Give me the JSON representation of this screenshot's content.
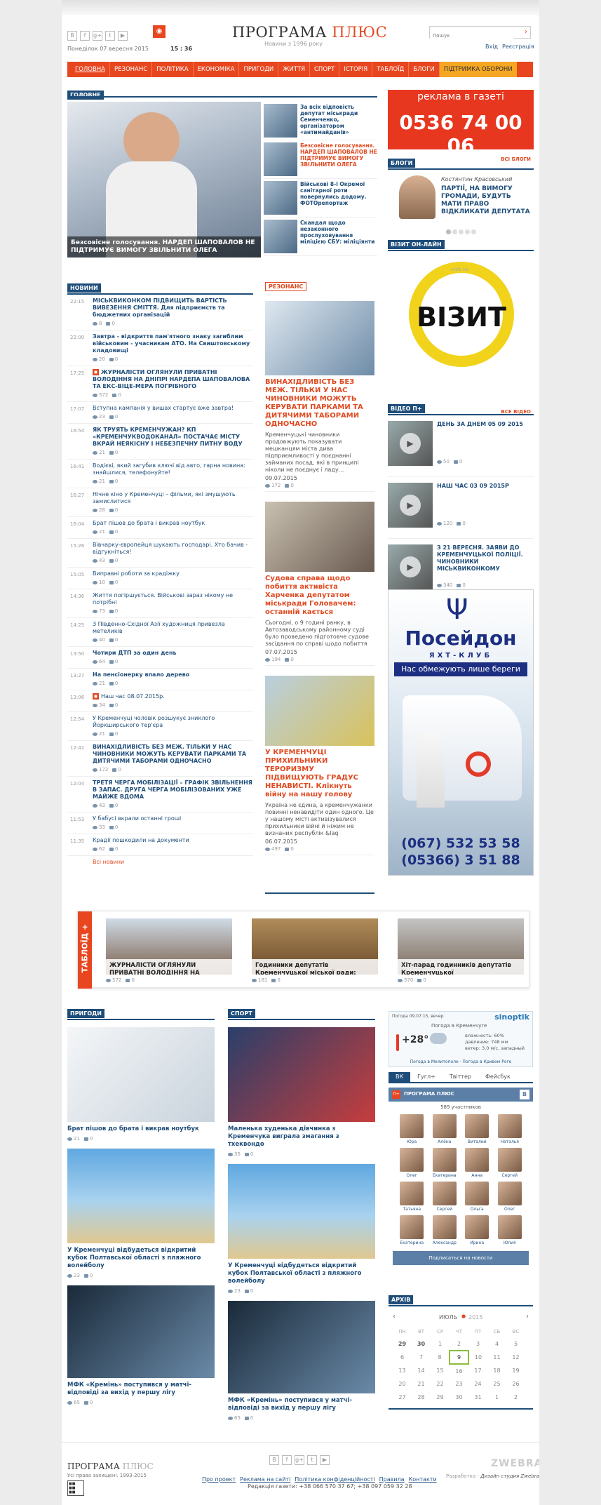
{
  "header": {
    "site_title_1": "ПРОГРАМА",
    "site_title_2": "ПЛЮС",
    "tagline": "Новини з 1996 року",
    "date": "Понеділок 07 вересня 2015",
    "time": "15 : 36",
    "search_placeholder": "Пошук",
    "login": "Вхід",
    "register": "Реєстрація",
    "social_icons": [
      "vk-icon",
      "facebook-icon",
      "google-plus-icon",
      "twitter-icon",
      "youtube-icon",
      "rss-icon"
    ]
  },
  "nav": [
    "ГОЛОВНА",
    "РЕЗОНАНС",
    "ПОЛІТИКА",
    "ЕКОНОМІКА",
    "ПРИГОДИ",
    "ЖИТТЯ",
    "СПОРТ",
    "ІСТОРІЯ",
    "ТАБЛОЇД",
    "БЛОГИ",
    "ПІДТРИМКА ОБОРОНИ"
  ],
  "main": {
    "label": "ГОЛОВНЕ",
    "big_caption": "Безсовісне голосування. НАРДЕП ШАПОВАЛОВ НЕ ПІДТРИМУЄ ВИМОГУ ЗВІЛЬНИТИ ОЛЕГА",
    "side": [
      "За всіх відповість депутат міськради Семенченко, організатором «антимайданів»",
      "Безсовісне голосування. НАРДЕП ШАПОВАЛОВ НЕ ПІДТРИМУЄ ВИМОГУ ЗВІЛЬНИТИ ОЛЕГА",
      "Військові 8-ї Окремої санітарної роти повернулись додому. ФОТОрепортаж",
      "Скандал щодо незаконного прослуховування міліцією СБУ: міліціянти"
    ]
  },
  "sidebar_ad": {
    "line1": "реклама в газеті",
    "phone": "0536 74 00 06"
  },
  "blogs": {
    "label": "БЛОГИ",
    "all": "ВСІ БЛОГИ",
    "author": "Костянтин Красовський",
    "text": "ПАРТІЇ, НА ВИМОГУ ГРОМАДИ, БУДУТЬ МАТИ ПРАВО ВІДКЛИКАТИ ДЕПУТАТА"
  },
  "vizit": {
    "label": "ВІЗИТ ОН-ЛАЙН",
    "logo": "ВІЗИТ",
    "web": "vizit.ua"
  },
  "video": {
    "label": "ВІДЕО П+",
    "all": "ВСЕ ВІДЕО",
    "items": [
      {
        "title": "ДЕНЬ ЗА ДНЕМ 05 09 2015",
        "views": "50",
        "comments": "0"
      },
      {
        "title": "НАШ ЧАС 03 09 2015Р",
        "views": "120",
        "comments": "0"
      },
      {
        "title": "З 21 ВЕРЕСНЯ. ЗАЯВИ ДО КРЕМЕНЧУЦЬКОЇ ПОЛІЦІЇ. ЧИНОВНИКИ МІСЬКВИКОНКОМУ",
        "views": "340",
        "comments": "0"
      }
    ]
  },
  "poseidon": {
    "title": "Посейдон",
    "sub": "ЯХТ-КЛУБ",
    "slogan": "Нас обмежують лише береги",
    "phone1": "(067) 532 53 58",
    "phone2": "(05366) 3 51 88"
  },
  "news": {
    "label": "НОВИНИ",
    "all": "Всі новини",
    "items": [
      {
        "time": "22:15",
        "text": "МІСЬКВИКОНКОМ ПІДВИЩИТЬ ВАРТІСТЬ ВИВЕЗЕННЯ СМІТТЯ. Для підприємств та бюджетних організацій",
        "views": "8",
        "comm": "0"
      },
      {
        "time": "22:00",
        "text": "Завтра - відкриття пам'ятного знаку загиблим військовим - учасникам АТО. На Свиштовському кладовищі",
        "views": "20",
        "comm": "0"
      },
      {
        "time": "17:25",
        "text": "ЖУРНАЛІСТИ ОГЛЯНУЛИ ПРИВАТНІ ВОЛОДІННЯ НА ДНІПРІ НАРДЕПА ШАПОВАЛОВА ТА ЕКС-ВІЦЕ-МЕРА ПОГРІБНОГО",
        "views": "572",
        "comm": "0"
      },
      {
        "time": "17:07",
        "text": "Вступна кампанія у вишах стартує вже завтра!",
        "views": "23",
        "comm": "0"
      },
      {
        "time": "16:54",
        "text": "ЯК ТРУЯТЬ КРЕМЕНЧУЖАН? КП «КРЕМЕНЧУКВОДОКАНАЛ» ПОСТАЧАЄ МІСТУ ВКРАЙ НЕЯКІСНУ І НЕБЕЗПЕЧНУ ПИТНУ ВОДУ",
        "views": "21",
        "comm": "0"
      },
      {
        "time": "16:41",
        "text": "Водієві, який загубив ключі від авто, гарна новина: знайшлися, телефонуйте!",
        "views": "21",
        "comm": "0"
      },
      {
        "time": "16:27",
        "text": "Нічне кіно у Кременчуці – фільми, які змушують замислитися",
        "views": "28",
        "comm": "0"
      },
      {
        "time": "16:04",
        "text": "Брат пішов до брата і викрав ноутбук",
        "views": "21",
        "comm": "0"
      },
      {
        "time": "15:26",
        "text": "Вівчарку-європейця шукають господарі. Хто бачив - відгукніться!",
        "views": "43",
        "comm": "0"
      },
      {
        "time": "15:05",
        "text": "Виправні роботи за крадіжку",
        "views": "10",
        "comm": "0"
      },
      {
        "time": "14:36",
        "text": "Життя погіршується. Військові зараз нікому не потрібні",
        "views": "73",
        "comm": "0"
      },
      {
        "time": "14:25",
        "text": "З Південно-Східної Азії художниця привезла метеликів",
        "views": "40",
        "comm": "0"
      },
      {
        "time": "13:50",
        "text": "Чотири ДТП за один день",
        "views": "64",
        "comm": "0"
      },
      {
        "time": "13:27",
        "text": "На пенсіонерку впало дерево",
        "views": "21",
        "comm": "0"
      },
      {
        "time": "13:06",
        "text": "Наш час 08.07.2015р.",
        "views": "34",
        "comm": "0"
      },
      {
        "time": "12:54",
        "text": "У Кременчуці чоловік розшукує зниклого Йоркширського тер'єра",
        "views": "21",
        "comm": "0"
      },
      {
        "time": "12:41",
        "text": "ВИНАХІДЛИВІСТЬ БЕЗ МЕЖ. ТІЛЬКИ У НАС ЧИНОВНИКИ МОЖУТЬ КЕРУВАТИ ПАРКАМИ ТА ДИТЯЧИМИ ТАБОРАМИ ОДНОЧАСНО",
        "views": "172",
        "comm": "0"
      },
      {
        "time": "12:04",
        "text": "ТРЕТЯ ЧЕРГА МОБІЛІЗАЦІЇ – ГРАФІК ЗВІЛЬНЕННЯ В ЗАПАС. ДРУГА ЧЕРГА МОБІЛІЗОВАНИХ УЖЕ МАЙЖЕ ВДОМА",
        "views": "43",
        "comm": "0"
      },
      {
        "time": "11:53",
        "text": "У бабусі вкрали останні гроші",
        "views": "33",
        "comm": "0"
      },
      {
        "time": "11:35",
        "text": "Крадії пошкодили на документи",
        "views": "62",
        "comm": "0"
      }
    ]
  },
  "resonance": {
    "label": "РЕЗОНАНС",
    "items": [
      {
        "title": "ВИНАХІДЛИВІСТЬ БЕЗ МЕЖ. ТІЛЬКИ У НАС ЧИНОВНИКИ МОЖУТЬ КЕРУВАТИ ПАРКАМИ ТА ДИТЯЧИМИ ТАБОРАМИ ОДНОЧАСНО",
        "text": "Кременчуцькі чиновники продовжують показувати мешканцям міста дива підприємливості у поєднанні займаних посад, які в принципі ніколи не поєднує і ладу...",
        "date": "09.07.2015",
        "views": "172",
        "comm": "0"
      },
      {
        "title": "Судова справа щодо побиття активіста Харченка депутатом міськради Головачем: останній кається",
        "text": "Сьогодні, о 9 годині ранку, в Автозаводському районному суді було проведено підготовче судове засідання по справі щодо побиття",
        "date": "07.07.2015",
        "views": "194",
        "comm": "0"
      },
      {
        "title": "У КРЕМЕНЧУЦІ ПРИХИЛЬНИКИ ТЕРОРИЗМУ ПІДВИЩУЮТЬ ГРАДУС НЕНАВИСТІ. Клікнуть війну на нашу голову",
        "text": "Україна не єдина, а кременчужанки повинні ненавидіти один одного. Це у нашому місті активізувалися прихильники війні й ніжим не визнаних республік &laq",
        "date": "06.07.2015",
        "views": "497",
        "comm": "0"
      }
    ]
  },
  "tabloid": {
    "label": "ТАБЛОЇД +",
    "items": [
      {
        "title": "ЖУРНАЛІСТИ ОГЛЯНУЛИ ПРИВАТНІ ВОЛОДІННЯ НА",
        "views": "572",
        "comm": "0"
      },
      {
        "title": "Годинники депутатів Кременчуцької міської ради:",
        "views": "181",
        "comm": "0"
      },
      {
        "title": "Хіт-парад годинників депутатів Кременчуцької",
        "views": "570",
        "comm": "0"
      }
    ]
  },
  "pryhody": {
    "label": "ПРИГОДИ",
    "items": [
      {
        "title": "Брат пішов до брата і викрав ноутбук",
        "views": "21",
        "comm": "0"
      },
      {
        "title": "У Кременчуці відбудеться відкритий кубок Полтавської області з пляжного волейболу",
        "views": "23",
        "comm": "0"
      },
      {
        "title": "МФК «Кремінь» поступився у матчі-відповіді за вихід у першу лігу",
        "views": "65",
        "comm": "0"
      }
    ]
  },
  "sport": {
    "label": "СПОРТ",
    "items": [
      {
        "title": "Маленька худенька дівчинка з Кременчука виграла змагання з тхеквондо",
        "views": "35",
        "comm": "0"
      },
      {
        "title": "У Кременчуці відбудеться відкритий кубок Полтавської області з пляжного волейболу",
        "views": "23",
        "comm": "0"
      },
      {
        "title": "МФК «Кремінь» поступився у матчі-відповіді за вихід у першу лігу",
        "views": "65",
        "comm": "0"
      }
    ]
  },
  "weather": {
    "head": "Погода 09.07.15, вечер",
    "brand": "sinoptik",
    "city": "Погода в Кременчуге",
    "temp": "+28°",
    "humidity": "влажность: 60%",
    "pressure": "давление: 748 мм",
    "wind": "ветер: 3.0 м/с, западный",
    "links": "Погода в Мелитополе · Погода в Кривом Роге"
  },
  "social": {
    "tabs": [
      "ВК",
      "Гугл+",
      "Твіттер",
      "Фейсбук"
    ],
    "group": "ПРОГРАМА ПЛЮС",
    "members": "589 участников",
    "people": [
      "Юра",
      "Алёна",
      "Виталий",
      "Наталья",
      "Олег",
      "Екатерина",
      "Анна",
      "Сергей",
      "Татьяна",
      "Сергей",
      "Ольга",
      "Олег",
      "Екатерина",
      "Александр",
      "Ирина",
      "Юлия"
    ],
    "subscribe": "Подписаться на новости"
  },
  "archive": {
    "label": "АРХІВ",
    "month": "ИЮЛЬ",
    "year": "2015",
    "days_head": [
      "ПН",
      "ВТ",
      "СР",
      "ЧТ",
      "ПТ",
      "СБ",
      "ВС"
    ],
    "weeks": [
      [
        "29",
        "30",
        "1",
        "2",
        "3",
        "4",
        "5"
      ],
      [
        "6",
        "7",
        "8",
        "9",
        "10",
        "11",
        "12"
      ],
      [
        "13",
        "14",
        "15",
        "16",
        "17",
        "18",
        "19"
      ],
      [
        "20",
        "21",
        "22",
        "23",
        "24",
        "25",
        "26"
      ],
      [
        "27",
        "28",
        "29",
        "30",
        "31",
        "1",
        "2"
      ]
    ]
  },
  "footer": {
    "logo_1": "ПРОГРАМА",
    "logo_2": "ПЛЮС",
    "rights": "Усі права захищені. 1993-2015",
    "links": [
      "Про проект",
      "Реклама на сайті",
      "Політика конфіденційності",
      "Правила",
      "Контакти"
    ],
    "editorial": "Редакція газети: +38 066 570 37 67; +38 097 059 32 28",
    "dev_label": "Разработка -",
    "dev": "Дизайн студия Zwebra",
    "dev_logo": "ZWEBRA"
  }
}
